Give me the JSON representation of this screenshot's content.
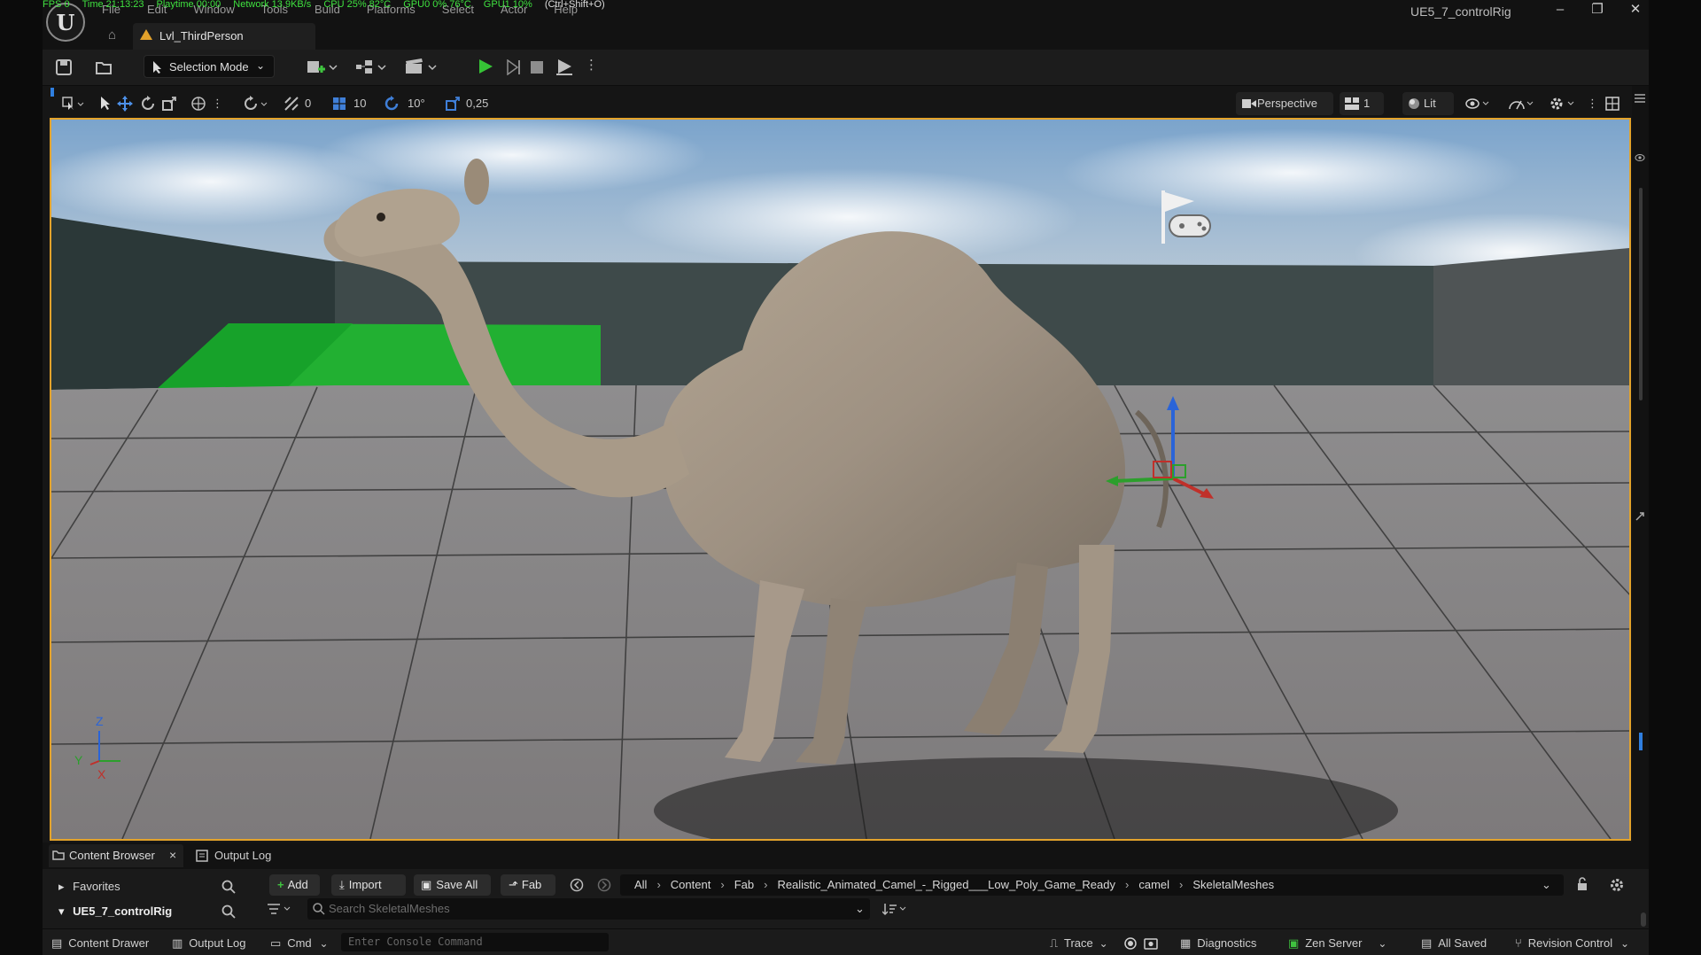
{
  "window": {
    "title": "UE5_7_controlRig",
    "controls": {
      "minimize": "–",
      "restore": "❐",
      "close": "✕"
    }
  },
  "stats_overlay": {
    "fps": "FPS 0",
    "time": "Time 21:13:23",
    "playtime": "Playtime 00:00",
    "network": "Network 13.9KB/s",
    "cpu": "CPU 25% 82°C",
    "gpu0": "GPU0 0% 76°C",
    "gpu1": "GPU1 10%",
    "shortcut": "(Ctrl+Shift+O)"
  },
  "menu": [
    "File",
    "Edit",
    "Window",
    "Tools",
    "Build",
    "Platforms",
    "Select",
    "Actor",
    "Help"
  ],
  "level_tab": {
    "label": "Lvl_ThirdPerson"
  },
  "main_toolbar": {
    "selection_mode": "Selection Mode"
  },
  "viewport_toolbar": {
    "translate_snap": "0",
    "grid_snap": "10",
    "rotate_snap": "10°",
    "scale_snap": "0,25",
    "camera_mode": "Perspective",
    "layout": "1",
    "view_mode": "Lit"
  },
  "axes": {
    "z": "Z",
    "y": "Y",
    "x": "X"
  },
  "bottom_tabs": {
    "content_browser": "Content Browser",
    "output_log": "Output Log",
    "close": "×"
  },
  "content_browser": {
    "favorites": "Favorites",
    "project": "UE5_7_controlRig",
    "add": "Add",
    "import": "Import",
    "save_all": "Save All",
    "fab": "Fab",
    "breadcrumbs": [
      "All",
      "Content",
      "Fab",
      "Realistic_Animated_Camel_-_Rigged___Low_Poly_Game_Ready",
      "camel",
      "SkeletalMeshes"
    ],
    "search_placeholder": "Search SkeletalMeshes"
  },
  "status_bar": {
    "content_drawer": "Content Drawer",
    "output_log": "Output Log",
    "cmd": "Cmd",
    "console_placeholder": "Enter Console Command",
    "trace": "Trace",
    "diagnostics": "Diagnostics",
    "zen_server": "Zen Server",
    "all_saved": "All Saved",
    "revision_control": "Revision Control"
  },
  "colors": {
    "accent_orange": "#e3a32b",
    "play_green": "#36c336",
    "stats_green": "#3fe23f"
  }
}
